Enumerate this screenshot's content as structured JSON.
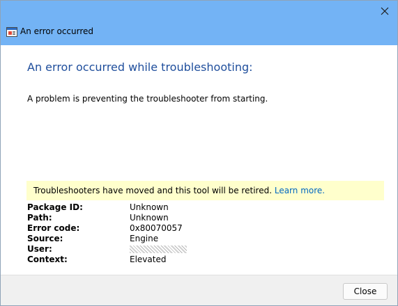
{
  "window": {
    "title": "An error occurred"
  },
  "content": {
    "heading": "An error occurred while troubleshooting:",
    "message": "A problem is preventing the troubleshooter from starting.",
    "notice_text": "Troubleshooters have moved and this tool will be retired.",
    "notice_link": "Learn more."
  },
  "details": [
    {
      "label": "Package ID:",
      "value": "Unknown"
    },
    {
      "label": "Path:",
      "value": "Unknown"
    },
    {
      "label": "Error code:",
      "value": "0x80070057"
    },
    {
      "label": "Source:",
      "value": "Engine"
    },
    {
      "label": "User:",
      "value": ""
    },
    {
      "label": "Context:",
      "value": "Elevated"
    }
  ],
  "footer": {
    "close_label": "Close"
  },
  "colors": {
    "titlebar": "#73b3f5",
    "heading": "#1f4e9c",
    "notice_bg": "#ffffcc",
    "link": "#0067c0"
  },
  "icons": {
    "window": "troubleshooter-window-icon",
    "close": "close-icon"
  }
}
